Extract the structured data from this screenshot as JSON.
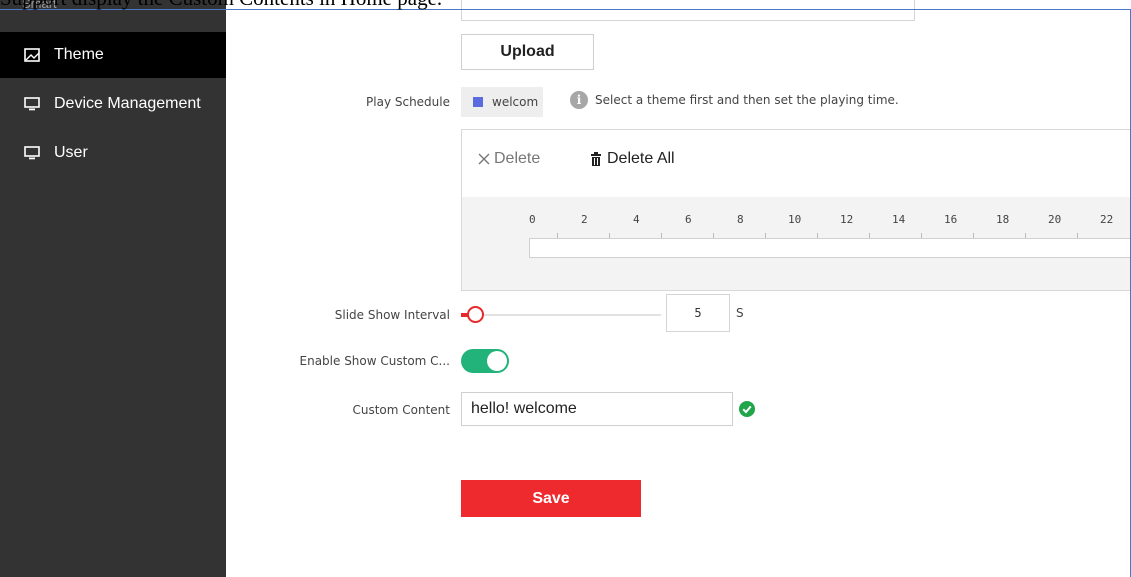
{
  "caption": "Support display the Custom Contents in Home page.",
  "sidebar": {
    "cut_item": "Smart",
    "items": [
      {
        "label": "Theme",
        "icon": "picture-icon",
        "active": true
      },
      {
        "label": "Device Management",
        "icon": "monitor-icon",
        "active": false
      },
      {
        "label": "User",
        "icon": "monitor-icon",
        "active": false
      }
    ]
  },
  "form": {
    "upload_label": "Upload",
    "play_schedule_label": "Play Schedule",
    "schedule_chip": "welcom",
    "schedule_hint": "Select a theme first and then set the playing time.",
    "delete_label": "Delete",
    "delete_all_label": "Delete All",
    "timeline_ticks": [
      "0",
      "2",
      "4",
      "6",
      "8",
      "10",
      "12",
      "14",
      "16",
      "18",
      "20",
      "22"
    ],
    "slide_interval_label": "Slide Show Interval",
    "slide_interval_value": "5",
    "slide_interval_unit": "S",
    "enable_custom_label": "Enable Show Custom C...",
    "enable_custom_on": true,
    "custom_content_label": "Custom Content",
    "custom_content_value": "hello! welcome",
    "save_label": "Save"
  },
  "colors": {
    "sidebar_bg": "#333333",
    "active_bg": "#000000",
    "accent_red": "#ee2a2f",
    "toggle_green": "#21b37a",
    "chip_square": "#5b6bdf"
  }
}
